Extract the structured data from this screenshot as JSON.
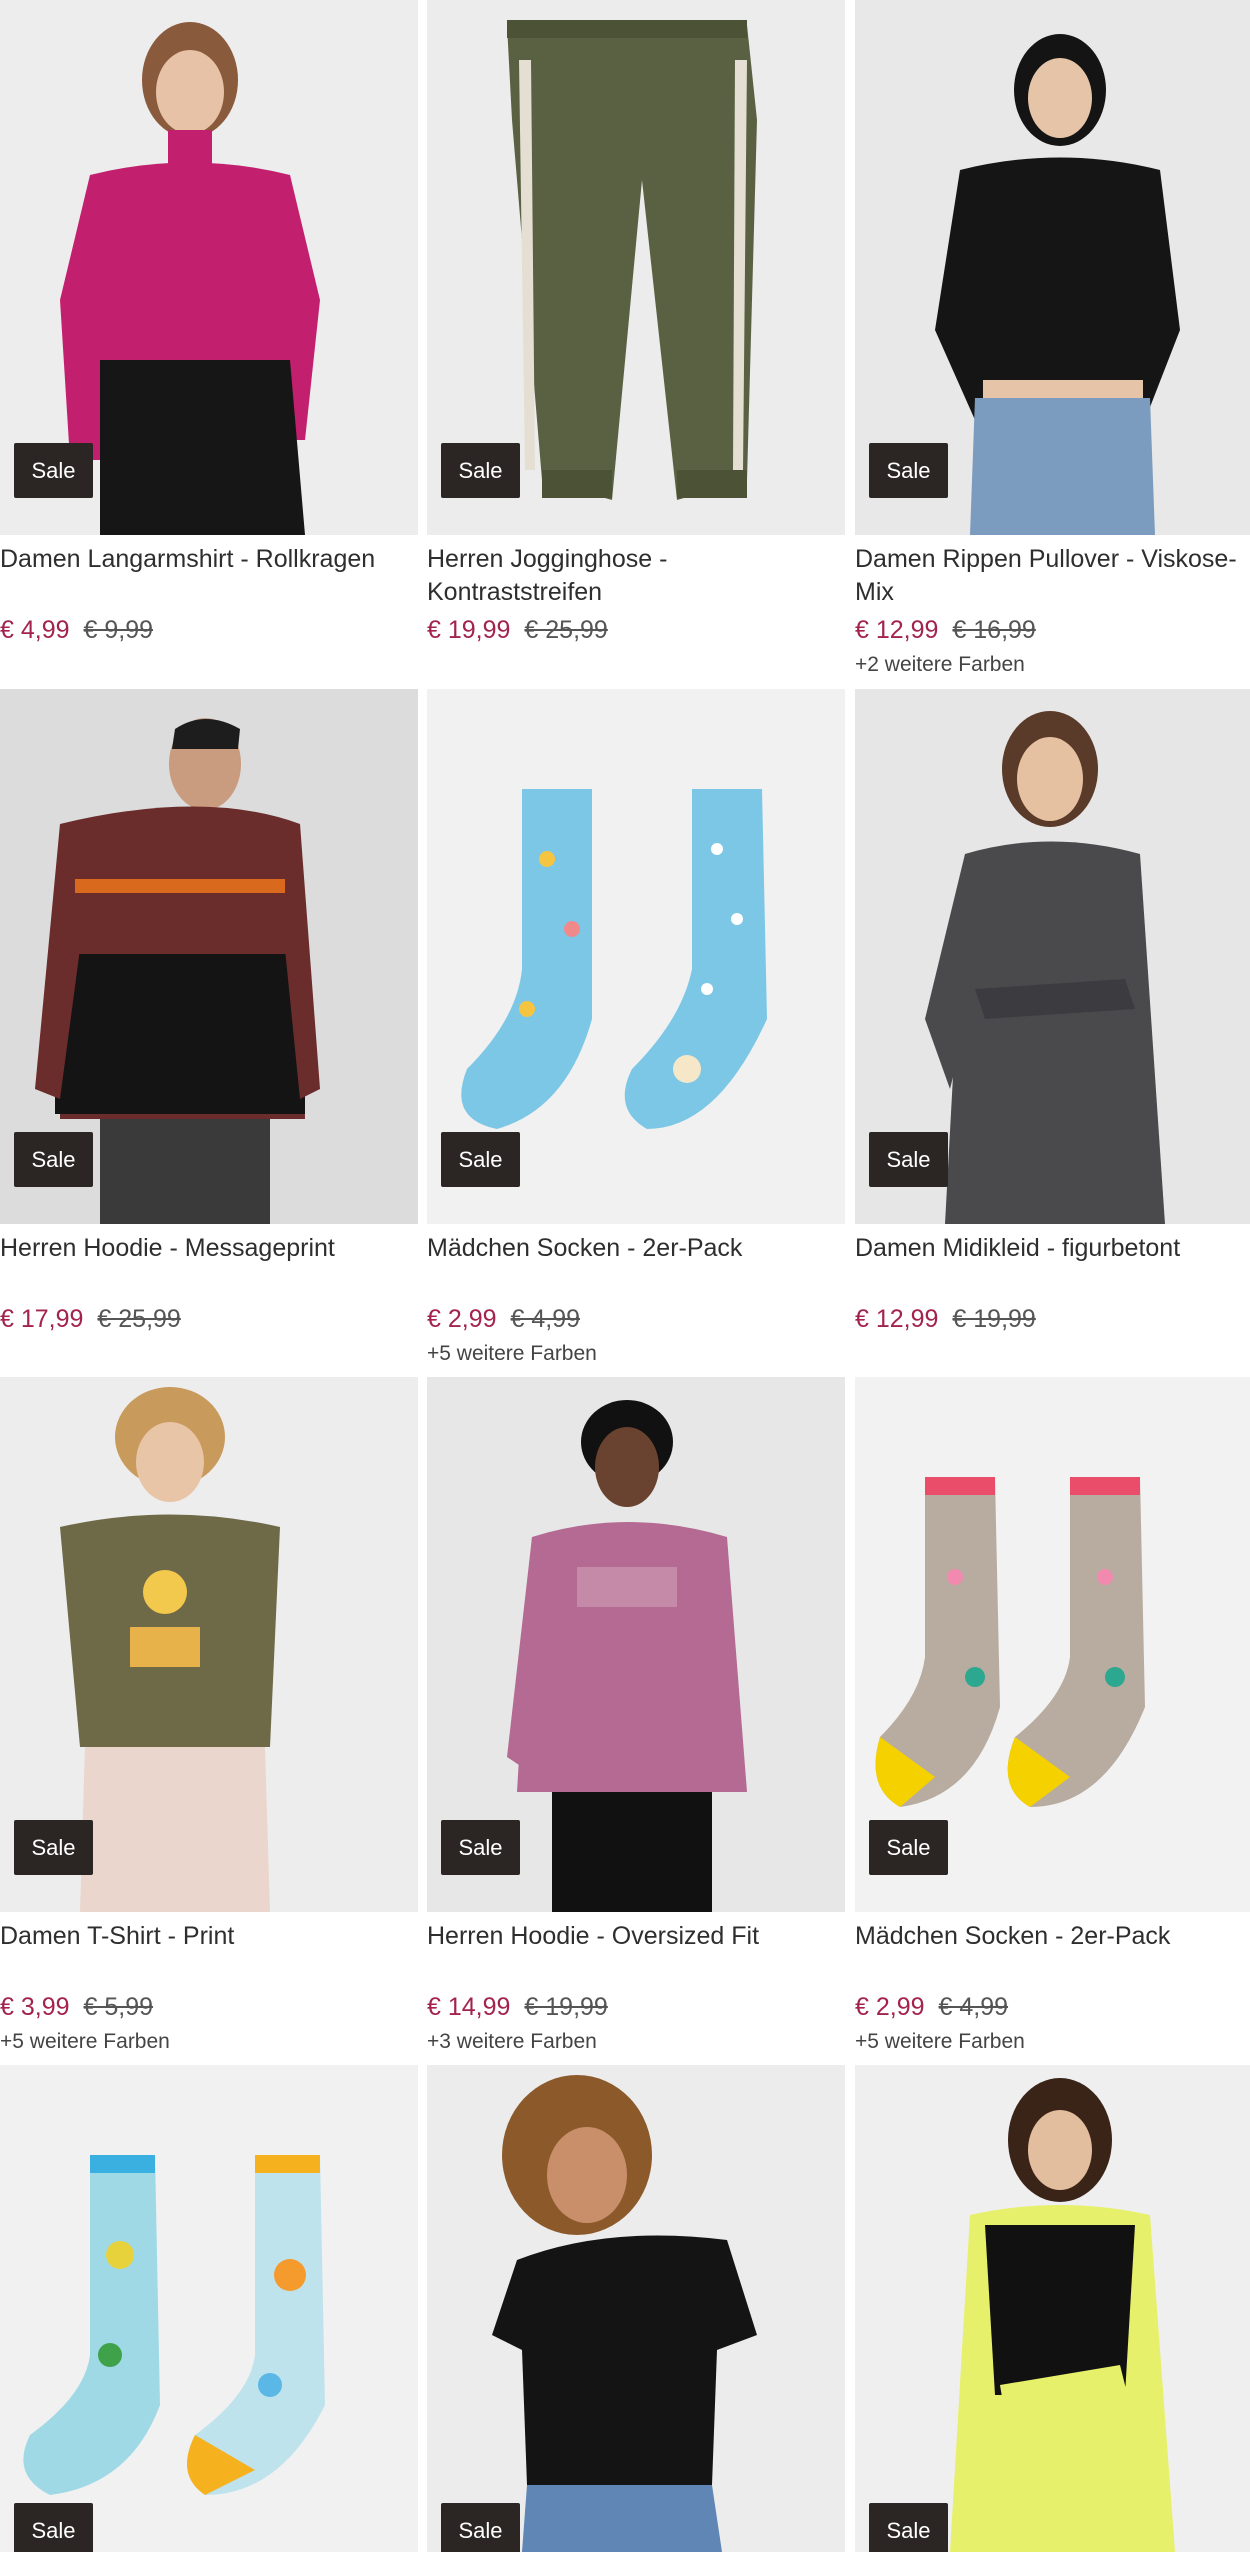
{
  "products": [
    {
      "name": "Damen Langarmshirt - Rollkragen",
      "price": "€ 4,99",
      "old_price": "€ 9,99",
      "colors": "",
      "badge": "Sale",
      "image": "woman-magenta-turtleneck-photo"
    },
    {
      "name": "Herren Jogginghose - Kontraststreifen",
      "price": "€ 19,99",
      "old_price": "€ 25,99",
      "colors": "",
      "badge": "Sale",
      "image": "olive-jogging-pants-photo"
    },
    {
      "name": "Damen Rippen Pullover - Viskose-Mix",
      "price": "€ 12,99",
      "old_price": "€ 16,99",
      "colors": "+2 weitere Farben",
      "badge": "Sale",
      "image": "woman-black-rib-pullover-photo"
    },
    {
      "name": "Herren Hoodie - Messageprint",
      "price": "€ 17,99",
      "old_price": "€ 25,99",
      "colors": "",
      "badge": "Sale",
      "image": "man-maroon-hoodie-photo"
    },
    {
      "name": "Mädchen Socken - 2er-Pack",
      "price": "€ 2,99",
      "old_price": "€ 4,99",
      "colors": "+5 weitere Farben",
      "badge": "Sale",
      "image": "blue-icecream-socks-photo"
    },
    {
      "name": "Damen Midikleid - figurbetont",
      "price": "€ 12,99",
      "old_price": "€ 19,99",
      "colors": "",
      "badge": "Sale",
      "image": "woman-grey-knit-dress-photo"
    },
    {
      "name": "Damen T-Shirt - Print",
      "price": "€ 3,99",
      "old_price": "€ 5,99",
      "colors": "+5 weitere Farben",
      "badge": "Sale",
      "image": "woman-olive-tshirt-photo"
    },
    {
      "name": "Herren Hoodie - Oversized Fit",
      "price": "€ 14,99",
      "old_price": "€ 19,99",
      "colors": "+3 weitere Farben",
      "badge": "Sale",
      "image": "man-mauve-hoodie-photo"
    },
    {
      "name": "Mädchen Socken - 2er-Pack",
      "price": "€ 2,99",
      "old_price": "€ 4,99",
      "colors": "+5 weitere Farben",
      "badge": "Sale",
      "image": "flamingo-socks-photo"
    },
    {
      "name": "",
      "price": "",
      "old_price": "",
      "colors": "",
      "badge": "Sale",
      "image": "monster-socks-photo"
    },
    {
      "name": "",
      "price": "",
      "old_price": "",
      "colors": "",
      "badge": "Sale",
      "image": "woman-black-tshirt-photo"
    },
    {
      "name": "",
      "price": "",
      "old_price": "",
      "colors": "",
      "badge": "Sale",
      "image": "woman-yellow-blouse-vest-photo"
    }
  ],
  "theme": {
    "price_color": "#a3234f",
    "badge_bg": "#2b2523"
  }
}
